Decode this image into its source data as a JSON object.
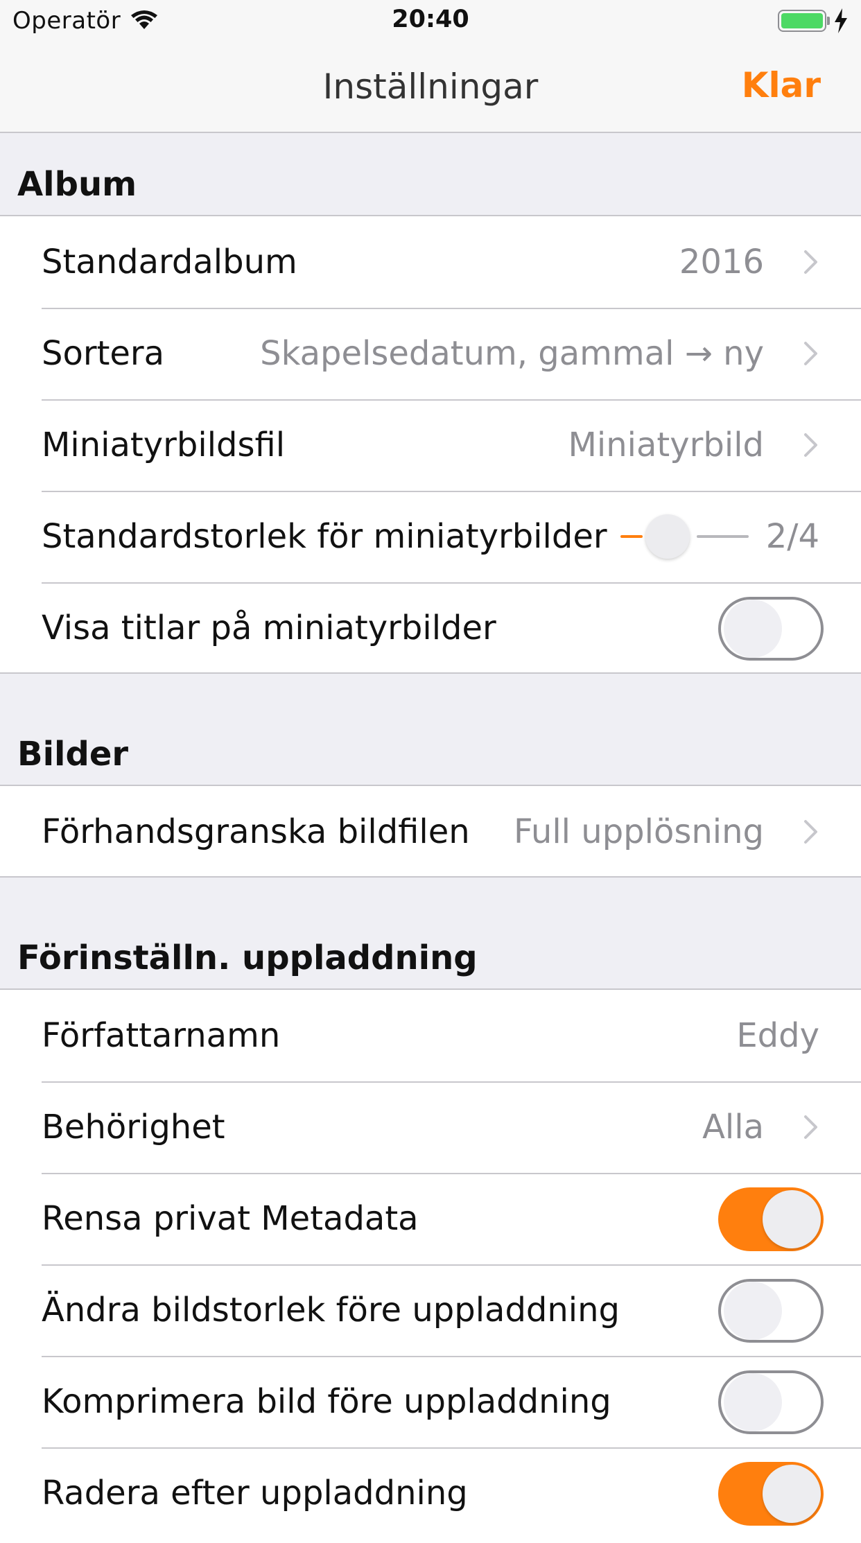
{
  "status_bar": {
    "carrier": "Operatör",
    "time": "20:40",
    "battery_icon": "battery-charging-icon",
    "wifi_icon": "wifi-icon"
  },
  "nav": {
    "title": "Inställningar",
    "done_label": "Klar"
  },
  "colors": {
    "accent": "#ff7f0e",
    "background": "#efeff4",
    "separator": "#c8c7cc",
    "secondary_text": "#8e8e93"
  },
  "album": {
    "header": "Album",
    "default_album": {
      "label": "Standardalbum",
      "value": "2016"
    },
    "sort": {
      "label": "Sortera",
      "value": "Skapelsedatum, gammal → ny"
    },
    "thumbnail_file": {
      "label": "Miniatyrbildsfil",
      "value": "Miniatyrbild"
    },
    "thumbnail_size": {
      "label": "Standardstorlek för miniatyrbilder",
      "value": "2/4",
      "level": 2,
      "max": 4
    },
    "show_titles": {
      "label": "Visa titlar på miniatyrbilder",
      "on": false
    }
  },
  "images": {
    "header": "Bilder",
    "preview_file": {
      "label": "Förhandsgranska bildfilen",
      "value": "Full upplösning"
    }
  },
  "upload": {
    "header": "Förinställn. uppladdning",
    "author": {
      "label": "Författarnamn",
      "value": "Eddy"
    },
    "permission": {
      "label": "Behörighet",
      "value": "Alla"
    },
    "strip_metadata": {
      "label": "Rensa privat Metadata",
      "on": true
    },
    "resize": {
      "label": "Ändra bildstorlek före uppladdning",
      "on": false
    },
    "compress": {
      "label": "Komprimera bild före uppladdning",
      "on": false
    },
    "delete_after": {
      "label": "Radera efter uppladdning",
      "on": true
    }
  }
}
